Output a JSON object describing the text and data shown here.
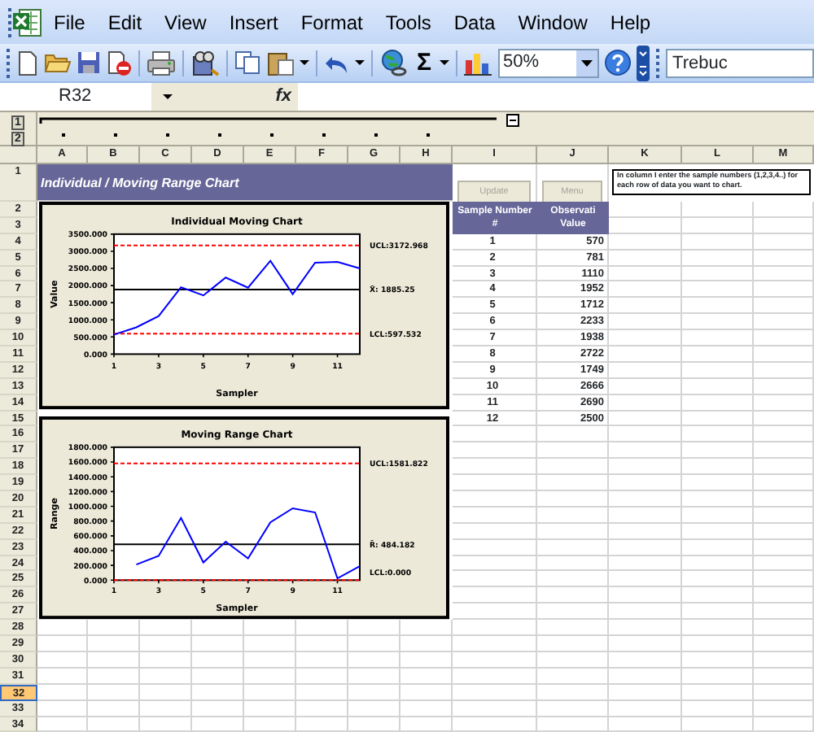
{
  "menu_bar": {
    "items": [
      "File",
      "Edit",
      "View",
      "Insert",
      "Format",
      "Tools",
      "Data",
      "Window",
      "Help"
    ]
  },
  "toolbar": {
    "autosum": "Σ",
    "zoom": "50%",
    "font": "Trebuc"
  },
  "formula_bar": {
    "name_box": "R32",
    "function_label": "fx"
  },
  "outline": {
    "levels": [
      "1",
      "2"
    ]
  },
  "sheet": {
    "columns": [
      {
        "label": "A",
        "selected": false
      },
      {
        "label": "B",
        "selected": false
      },
      {
        "label": "C",
        "selected": false
      },
      {
        "label": "D",
        "selected": false
      },
      {
        "label": "E",
        "selected": false
      },
      {
        "label": "F",
        "selected": false
      },
      {
        "label": "G",
        "selected": false
      },
      {
        "label": "H",
        "selected": false
      },
      {
        "label": "I",
        "selected": false
      },
      {
        "label": "J",
        "selected": false
      },
      {
        "label": "K",
        "selected": false
      },
      {
        "label": "L",
        "selected": false
      },
      {
        "label": "M",
        "selected": false
      }
    ],
    "rows": [
      {
        "label": "1",
        "selected": false
      },
      {
        "label": "2",
        "selected": false
      },
      {
        "label": "3",
        "selected": false
      },
      {
        "label": "4",
        "selected": false
      },
      {
        "label": "5",
        "selected": false
      },
      {
        "label": "6",
        "selected": false
      },
      {
        "label": "7",
        "selected": false
      },
      {
        "label": "8",
        "selected": false
      },
      {
        "label": "9",
        "selected": false
      },
      {
        "label": "10",
        "selected": false
      },
      {
        "label": "11",
        "selected": false
      },
      {
        "label": "12",
        "selected": false
      },
      {
        "label": "13",
        "selected": false
      },
      {
        "label": "14",
        "selected": false
      },
      {
        "label": "15",
        "selected": false
      },
      {
        "label": "16",
        "selected": false
      },
      {
        "label": "17",
        "selected": false
      },
      {
        "label": "18",
        "selected": false
      },
      {
        "label": "19",
        "selected": false
      },
      {
        "label": "20",
        "selected": false
      },
      {
        "label": "21",
        "selected": false
      },
      {
        "label": "22",
        "selected": false
      },
      {
        "label": "23",
        "selected": false
      },
      {
        "label": "24",
        "selected": false
      },
      {
        "label": "25",
        "selected": false
      },
      {
        "label": "26",
        "selected": false
      },
      {
        "label": "27",
        "selected": false
      },
      {
        "label": "28",
        "selected": false
      },
      {
        "label": "29",
        "selected": false
      },
      {
        "label": "30",
        "selected": false
      },
      {
        "label": "31",
        "selected": false
      },
      {
        "label": "32",
        "selected": true
      },
      {
        "label": "33",
        "selected": false
      },
      {
        "label": "34",
        "selected": false
      }
    ],
    "title": "Individual / Moving Range Chart",
    "buttons": [
      {
        "label": "Update",
        "disabled": true
      },
      {
        "label": "Menu",
        "disabled": true
      }
    ],
    "note": "In column I enter the sample numbers (1,2,3,4..) for each row of data you want to chart.",
    "table": {
      "columns": [
        {
          "label": "Sample Number",
          "sublabel": "#"
        },
        {
          "label": "Observati",
          "sublabel": "Value"
        }
      ],
      "rows": [
        [
          "1",
          "570"
        ],
        [
          "2",
          "781"
        ],
        [
          "3",
          "1110"
        ],
        [
          "4",
          "1952"
        ],
        [
          "5",
          "1712"
        ],
        [
          "6",
          "2233"
        ],
        [
          "7",
          "1938"
        ],
        [
          "8",
          "2722"
        ],
        [
          "9",
          "1749"
        ],
        [
          "10",
          "2666"
        ],
        [
          "11",
          "2690"
        ],
        [
          "12",
          "2500"
        ]
      ]
    },
    "charts": [
      {
        "chart_data": {
          "type": "line",
          "title": "Individual Moving Chart",
          "xlabel": "Sampler",
          "ylabel": "Value",
          "x": [
            1,
            2,
            3,
            4,
            5,
            6,
            7,
            8,
            9,
            10,
            11,
            12
          ],
          "series": [
            {
              "color": "#0000ff",
              "values": [
                570,
                781,
                1110,
                1952,
                1712,
                2233,
                1938,
                2722,
                1749,
                2666,
                2690,
                2500
              ]
            }
          ],
          "xlim": [
            1,
            12
          ],
          "ylim": [
            0,
            3500
          ],
          "xticks": [
            1,
            3,
            5,
            7,
            9,
            11
          ],
          "yticks": [
            {
              "value": 0,
              "label": "0.000"
            },
            {
              "value": 500,
              "label": "500.000"
            },
            {
              "value": 1000,
              "label": "1000.000"
            },
            {
              "value": 1500,
              "label": "1500.000"
            },
            {
              "value": 2000,
              "label": "2000.000"
            },
            {
              "value": 2500,
              "label": "2500.000"
            },
            {
              "value": 3000,
              "label": "3000.000"
            },
            {
              "value": 3500,
              "label": "3500.000"
            }
          ],
          "ref_lines": [
            {
              "axis": "y",
              "value": 3172.968,
              "label": "UCL:3172.968",
              "color": "#ff0000"
            },
            {
              "axis": "y",
              "value": 1885.25,
              "label": "X̄:  1885.25",
              "color": "#000000"
            },
            {
              "axis": "y",
              "value": 597.532,
              "label": "LCL:597.532",
              "color": "#ff0000"
            }
          ]
        }
      },
      {
        "chart_data": {
          "type": "line",
          "title": "Moving Range Chart",
          "xlabel": "Sampler",
          "ylabel": "Range",
          "x": [
            2,
            3,
            4,
            5,
            6,
            7,
            8,
            9,
            10,
            11,
            12
          ],
          "series": [
            {
              "color": "#0000ff",
              "values": [
                211,
                329,
                842,
                240,
                521,
                295,
                784,
                973,
                917,
                24,
                190
              ]
            }
          ],
          "xlim": [
            1,
            12
          ],
          "ylim": [
            0,
            1800
          ],
          "xticks": [
            1,
            3,
            5,
            7,
            9,
            11
          ],
          "yticks": [
            {
              "value": 0,
              "label": "0.000"
            },
            {
              "value": 200,
              "label": "200.000"
            },
            {
              "value": 400,
              "label": "400.000"
            },
            {
              "value": 600,
              "label": "600.000"
            },
            {
              "value": 800,
              "label": "800.000"
            },
            {
              "value": 1000,
              "label": "1000.000"
            },
            {
              "value": 1200,
              "label": "1200.000"
            },
            {
              "value": 1400,
              "label": "1400.000"
            },
            {
              "value": 1600,
              "label": "1600.000"
            },
            {
              "value": 1800,
              "label": "1800.000"
            }
          ],
          "ref_lines": [
            {
              "axis": "y",
              "value": 1581.822,
              "label": "UCL:1581.822",
              "color": "#ff0000"
            },
            {
              "axis": "y",
              "value": 484.182,
              "label": "R̄:  484.182",
              "color": "#000000"
            },
            {
              "axis": "y",
              "value": 0,
              "label": "LCL:0.000",
              "color": "#ff0000"
            }
          ]
        }
      }
    ]
  }
}
